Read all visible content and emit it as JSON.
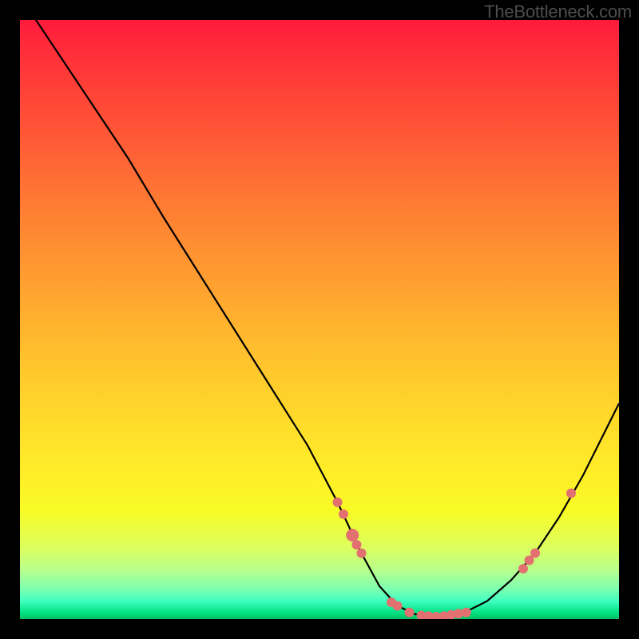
{
  "watermark": "TheBottleneck.com",
  "chart_data": {
    "type": "line",
    "title": "",
    "xlabel": "",
    "ylabel": "",
    "xlim": [
      0,
      100
    ],
    "ylim": [
      0,
      100
    ],
    "grid": false,
    "series": [
      {
        "name": "curve",
        "x": [
          0,
          6,
          12,
          18,
          24,
          30,
          36,
          42,
          48,
          53,
          57,
          60,
          63,
          66,
          70,
          74,
          78,
          82,
          86,
          90,
          94,
          100
        ],
        "y": [
          104,
          95,
          86,
          77,
          67,
          57.5,
          48,
          38.5,
          29,
          19.5,
          11,
          5.5,
          2.2,
          0.8,
          0.4,
          1.0,
          3.0,
          6.5,
          11,
          17,
          24,
          36
        ]
      }
    ],
    "markers": [
      {
        "x": 53,
        "y": 19.5,
        "r": 6
      },
      {
        "x": 54,
        "y": 17.5,
        "r": 6
      },
      {
        "x": 55.5,
        "y": 14.0,
        "r": 8
      },
      {
        "x": 56.2,
        "y": 12.4,
        "r": 6
      },
      {
        "x": 57.0,
        "y": 11.0,
        "r": 6
      },
      {
        "x": 62.0,
        "y": 2.8,
        "r": 6
      },
      {
        "x": 63.0,
        "y": 2.2,
        "r": 6
      },
      {
        "x": 65.0,
        "y": 1.1,
        "r": 6
      },
      {
        "x": 67.0,
        "y": 0.6,
        "r": 6
      },
      {
        "x": 68.2,
        "y": 0.5,
        "r": 6
      },
      {
        "x": 69.5,
        "y": 0.4,
        "r": 6
      },
      {
        "x": 70.8,
        "y": 0.5,
        "r": 6
      },
      {
        "x": 72.0,
        "y": 0.7,
        "r": 6
      },
      {
        "x": 73.2,
        "y": 0.9,
        "r": 6
      },
      {
        "x": 74.5,
        "y": 1.1,
        "r": 6
      },
      {
        "x": 84.0,
        "y": 8.4,
        "r": 6
      },
      {
        "x": 85.0,
        "y": 9.8,
        "r": 6
      },
      {
        "x": 86.0,
        "y": 11.0,
        "r": 6
      },
      {
        "x": 92.0,
        "y": 21.0,
        "r": 6
      }
    ],
    "colors": {
      "curve_stroke": "#000000",
      "marker_fill": "#e27070"
    }
  }
}
